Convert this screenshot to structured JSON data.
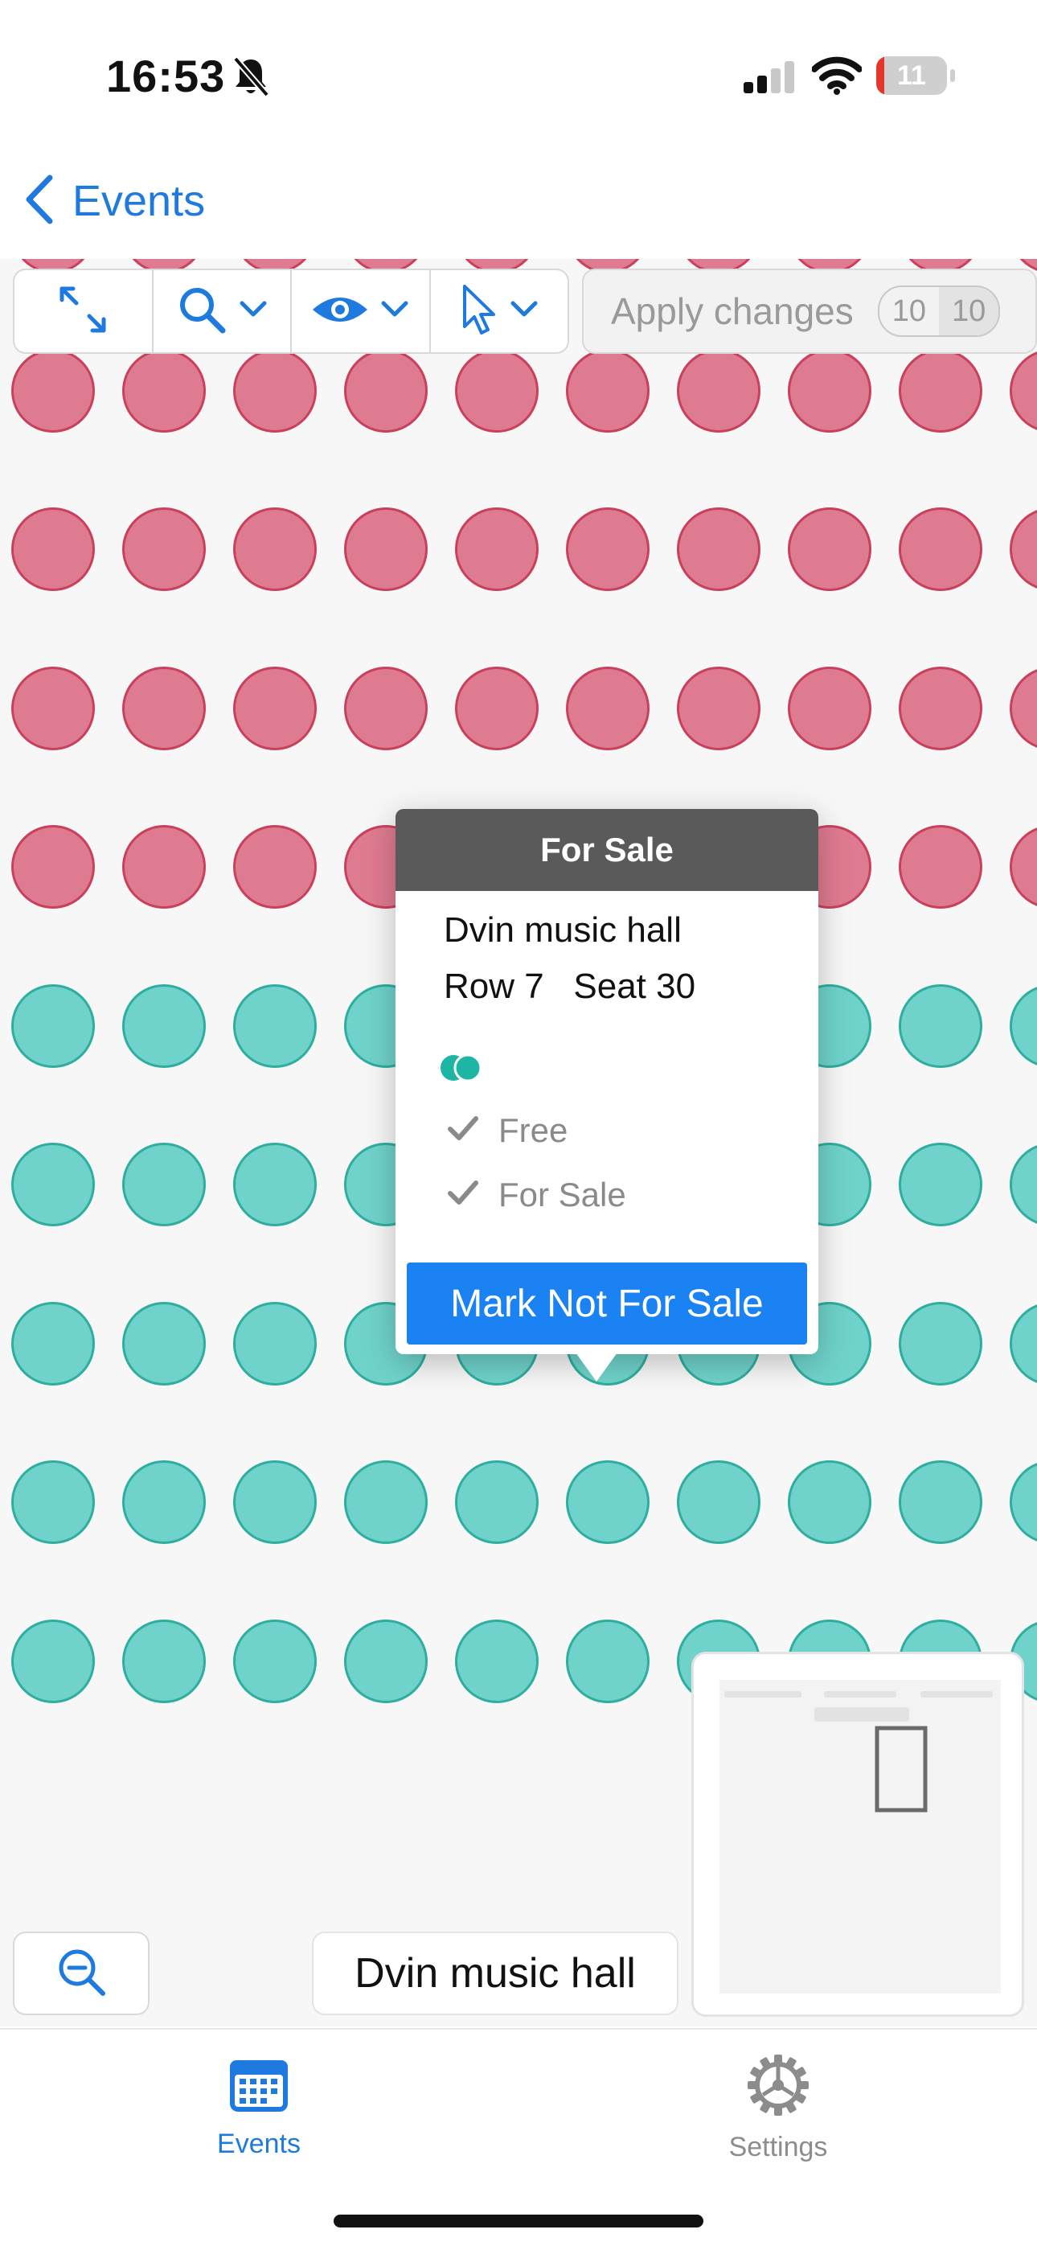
{
  "status_bar": {
    "time": "16:53",
    "battery_level": "11",
    "battery_fraction": 0.11
  },
  "nav": {
    "back_label": "Events"
  },
  "toolbar": {
    "apply_label": "Apply changes",
    "badge_left": "10",
    "badge_right": "10"
  },
  "popover": {
    "header": "For Sale",
    "venue": "Dvin music hall",
    "row_seat": "Row 7   Seat 30",
    "items": [
      "Free",
      "For Sale"
    ],
    "button_label": "Mark Not For Sale"
  },
  "venue_chip": "Dvin music hall",
  "tabs": [
    {
      "label": "Events",
      "active": true
    },
    {
      "label": "Settings",
      "active": false
    }
  ],
  "colors": {
    "accent": "#1a82f2",
    "seat_booked": "#df7b90",
    "seat_free": "#6fd3cb",
    "seat_selected": "#1fb5a5"
  },
  "seat_map": {
    "rows": 10,
    "columns": 10,
    "booked_rows": [
      1,
      2,
      3,
      4,
      5
    ],
    "free_rows": [
      6,
      7,
      8,
      9,
      10
    ],
    "selected_seat": {
      "row": 7,
      "column": 6
    }
  }
}
